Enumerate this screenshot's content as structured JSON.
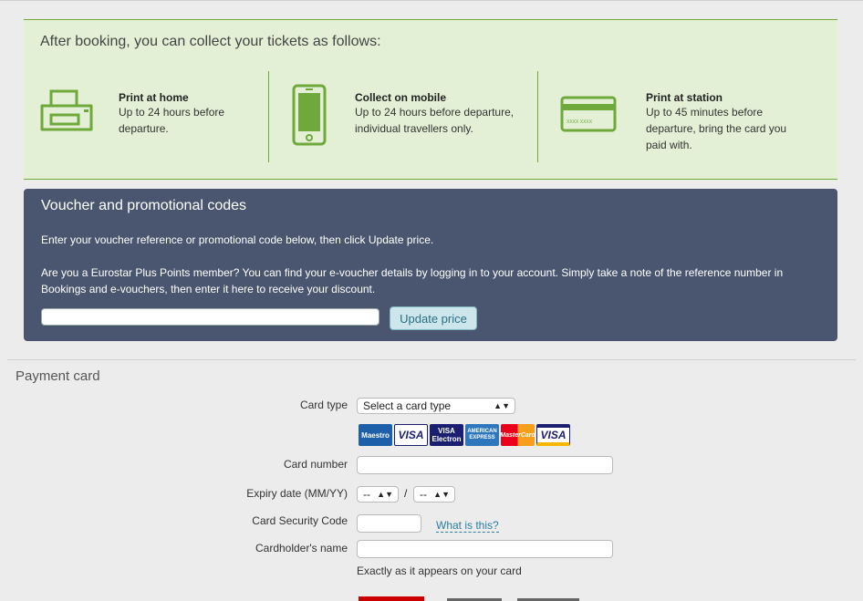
{
  "collect": {
    "heading": "After booking, you can collect your tickets as follows:",
    "options": [
      {
        "title": "Print at home",
        "desc": "Up to 24 hours before departure.",
        "icon": "printer-icon"
      },
      {
        "title": "Collect on mobile",
        "desc": "Up to 24 hours before departure, individual travellers only.",
        "icon": "mobile-phone-icon"
      },
      {
        "title": "Print at station",
        "desc": "Up to 45 minutes before departure, bring the card you paid with.",
        "icon": "credit-card-icon"
      }
    ],
    "card_icon_text": "XXXX XXXX"
  },
  "voucher": {
    "heading": "Voucher and promotional codes",
    "instruction": "Enter your voucher reference or promotional code below, then click Update price.",
    "plus_points": "Are you a Eurostar Plus Points member? You can find your e-voucher details by logging in to your account. Simply take a note of the reference number in Bookings and e-vouchers, then enter it here to receive your discount.",
    "input_value": "",
    "button_label": "Update price"
  },
  "payment": {
    "heading": "Payment card",
    "card_type_label": "Card type",
    "card_type_value": "Select a card type",
    "card_logos": [
      "Maestro",
      "VISA",
      "VISA Electron",
      "AMERICAN EXPRESS",
      "MasterCard",
      "VISA"
    ],
    "card_number_label": "Card number",
    "expiry_label": "Expiry date (MM/YY)",
    "expiry_month": "--",
    "expiry_sep": "/",
    "expiry_year": "--",
    "csc_label": "Card Security Code",
    "csc_help": "What is this?",
    "holder_label": "Cardholder's name",
    "holder_note": "Exactly as it appears on your card"
  },
  "colors": {
    "green": "#6fa83b",
    "voucher_bg": "#4a5670",
    "button_bg": "#cde6ec"
  }
}
